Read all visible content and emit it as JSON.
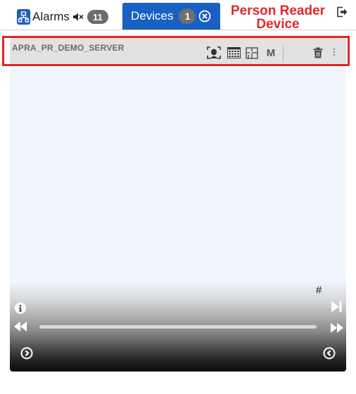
{
  "tabs": {
    "alarms": {
      "label": "Alarms",
      "count": "11",
      "icon": "network-icon",
      "sound_icon": "mute-icon"
    },
    "devices": {
      "label": "Devices",
      "count": "1",
      "close_icon": "close-circle-icon",
      "active": true
    }
  },
  "annotation": {
    "text": "Person Reader Device",
    "color": "#e02828"
  },
  "exit_icon": "exit-icon",
  "device_panel": {
    "device_name": "APRA_PR_DEMO_SERVER",
    "toolbar": [
      {
        "name": "face-scan-icon"
      },
      {
        "name": "keypad-icon"
      },
      {
        "name": "floorplan-icon"
      },
      {
        "name": "m-button",
        "label": "M"
      },
      {
        "name": "delete-icon"
      },
      {
        "name": "more-options-icon"
      }
    ]
  },
  "player": {
    "channel_label": "#",
    "progress": 0.0,
    "icons": [
      "info-icon",
      "skip-end-icon",
      "rewind-icon",
      "fast-forward-icon",
      "prev-circle-icon",
      "next-circle-icon"
    ]
  },
  "colors": {
    "tab_active": "#1760c4",
    "badge": "#6c6c6c",
    "annotation_red": "#e32626",
    "panel_bg": "#f1f6fc",
    "header_bg": "#e2e2e2"
  }
}
